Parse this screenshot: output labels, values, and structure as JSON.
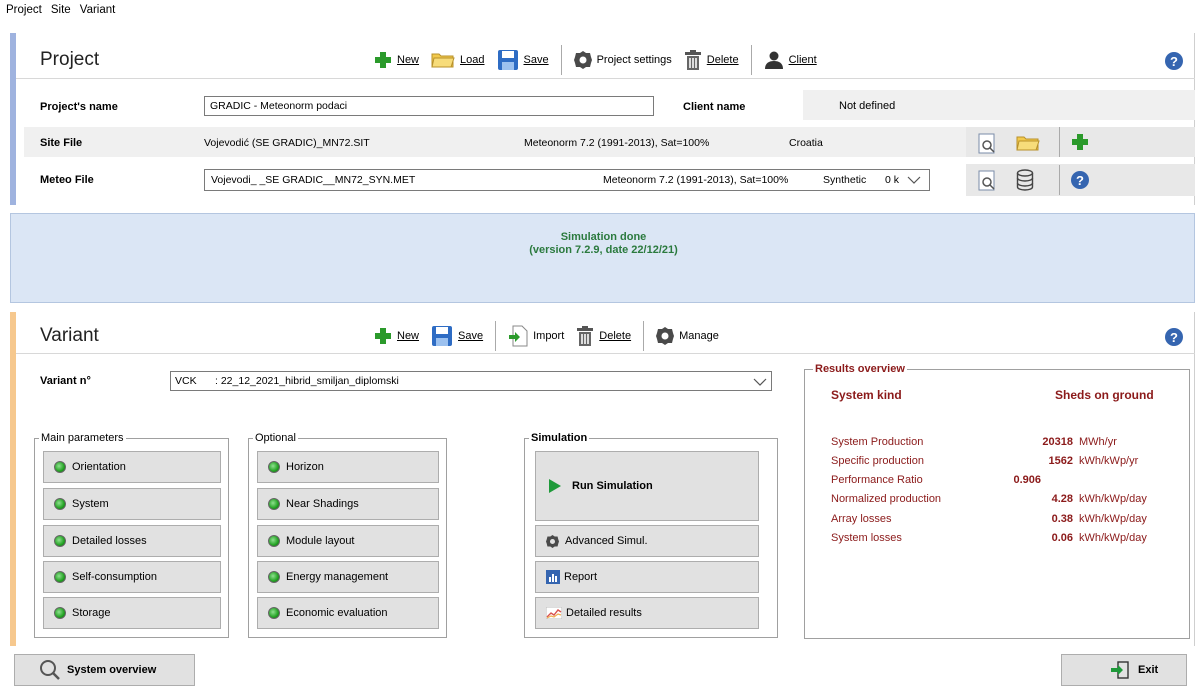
{
  "menu": {
    "project": "Project",
    "site": "Site",
    "variant": "Variant"
  },
  "project": {
    "title": "Project",
    "toolbar": {
      "new": "New",
      "load": "Load",
      "save": "Save",
      "settings": "Project settings",
      "delete": "Delete",
      "client": "Client"
    },
    "name_label": "Project's name",
    "name_value": "GRADIC - Meteonorm podaci",
    "client_label": "Client name",
    "client_value": "Not defined",
    "site_label": "Site File",
    "site_file": "Vojevodić (SE GRADIC)_MN72.SIT",
    "site_source": "Meteonorm 7.2 (1991-2013), Sat=100%",
    "site_country": "Croatia",
    "meteo_label": "Meteo File",
    "meteo_file": "Vojevodi_ _SE GRADIC__MN72_SYN.MET",
    "meteo_source": "Meteonorm 7.2 (1991-2013), Sat=100%",
    "meteo_type": "Synthetic",
    "meteo_extra": "0 k"
  },
  "simulation_status": {
    "line1": "Simulation done",
    "line2": "(version 7.2.9, date 22/12/21)"
  },
  "variant": {
    "title": "Variant",
    "toolbar": {
      "new": "New",
      "save": "Save",
      "import": "Import",
      "delete": "Delete",
      "manage": "Manage"
    },
    "number_label": "Variant n°",
    "code": "VCK",
    "name": ": 22_12_2021_hibrid_smiljan_diplomski",
    "main_params": {
      "title": "Main parameters",
      "items": [
        "Orientation",
        "System",
        "Detailed losses",
        "Self-consumption",
        "Storage"
      ]
    },
    "optional": {
      "title": "Optional",
      "items": [
        "Horizon",
        "Near Shadings",
        "Module layout",
        "Energy management",
        "Economic evaluation"
      ]
    },
    "simulation": {
      "title": "Simulation",
      "run": "Run Simulation",
      "advanced": "Advanced Simul.",
      "report": "Report",
      "detailed": "Detailed results"
    }
  },
  "results": {
    "title": "Results overview",
    "system_kind_label": "System kind",
    "system_kind_value": "Sheds on ground",
    "rows": [
      {
        "label": "System Production",
        "value": "20318",
        "unit": "MWh/yr"
      },
      {
        "label": "Specific production",
        "value": "1562",
        "unit": "kWh/kWp/yr"
      },
      {
        "label": "Performance Ratio",
        "value": "0.906",
        "unit": ""
      },
      {
        "label": "Normalized production",
        "value": "4.28",
        "unit": "kWh/kWp/day"
      },
      {
        "label": "Array losses",
        "value": "0.38",
        "unit": "kWh/kWp/day"
      },
      {
        "label": "System losses",
        "value": "0.06",
        "unit": "kWh/kWp/day"
      }
    ]
  },
  "footer": {
    "system_overview": "System overview",
    "exit": "Exit"
  },
  "colors": {
    "accent_blue": "#9fb3df",
    "accent_orange": "#f6c88e",
    "result_red": "#8b1a1a",
    "sim_green": "#2b7a3e"
  }
}
